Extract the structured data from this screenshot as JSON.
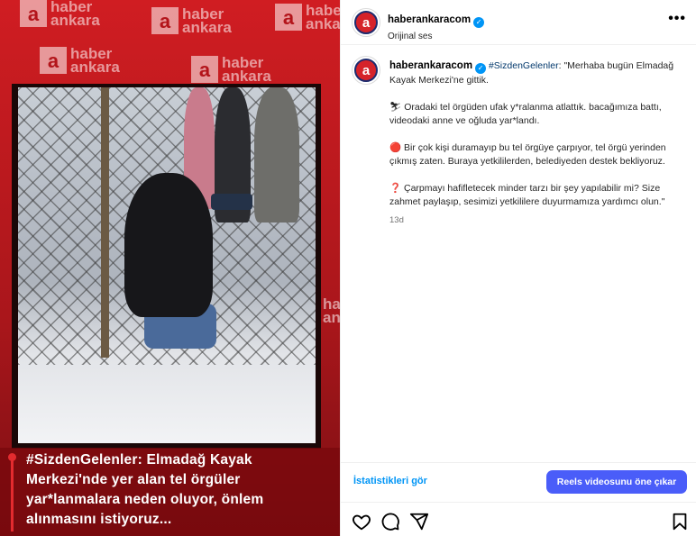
{
  "media": {
    "watermark_line1": "haber",
    "watermark_line2": "ankara",
    "watermark_logo_letter": "a",
    "caption": "#SizdenGelenler: Elmadağ Kayak Merkezi'nde yer alan tel örgüler yar*lanmalara neden oluyor, önlem alınmasını istiyoruz..."
  },
  "header": {
    "username": "haberankaracom",
    "subtitle": "Orijinal ses",
    "more_icon": "•••"
  },
  "post": {
    "username": "haberankaracom",
    "hashtag": "#SizdenGelenler",
    "intro": ": \"Merhaba bugün Elmadağ Kayak Merkezi'ne gittik.",
    "p1_emoji": "⛷",
    "p1": " Oradaki tel örgüden ufak y*ralanma atlattık. bacağımıza battı, videodaki anne ve oğluda yar*landı.",
    "p2_emoji": "🔴",
    "p2": " Bir çok kişi duramayıp bu tel örgüye çarpıyor, tel örgü yerinden çıkmış zaten. Buraya yetkililerden, belediyeden destek bekliyoruz.",
    "p3_emoji": "❓",
    "p3": " Çarpmayı hafifletecek minder tarzı bir şey yapılabilir mi? Size zahmet paylaşıp, sesimizi yetkililere duyurmamıza yardımcı olun.\"",
    "age": "13d"
  },
  "actions": {
    "insights": "İstatistikleri gör",
    "boost": "Reels videosunu öne çıkar"
  },
  "colors": {
    "accent": "#0095f6",
    "boost_button": "#4a5df9",
    "brand_red": "#d6232a"
  }
}
